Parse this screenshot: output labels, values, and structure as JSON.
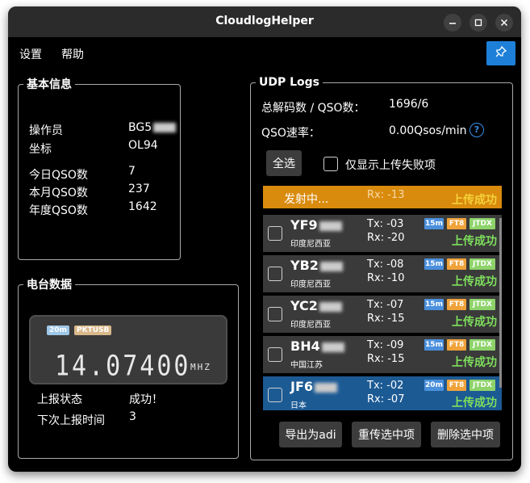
{
  "window": {
    "title": "CloudlogHelper"
  },
  "menu": {
    "items": [
      "设置",
      "帮助"
    ]
  },
  "basic_info": {
    "legend": "基本信息",
    "operator_label": "操作员",
    "operator_value": "BG5",
    "grid_label": "坐标",
    "grid_value": "OL94",
    "today_label": "今日QSO数",
    "today_value": "7",
    "month_label": "本月QSO数",
    "month_value": "237",
    "year_label": "年度QSO数",
    "year_value": "1642"
  },
  "radio": {
    "legend": "电台数据",
    "band_tag": "20m",
    "mode_tag": "PKTUSB",
    "frequency": "14.07400",
    "unit": "MHZ",
    "report_status_label": "上报状态",
    "report_status_value": "成功！",
    "next_report_label": "下次上报时间",
    "next_report_value": "3"
  },
  "udp": {
    "legend": "UDP Logs",
    "decode_label": "总解码数 / QSO数：",
    "decode_value": "1696/6",
    "rate_label": "QSO速率：",
    "rate_value": "0.00Qsos/min",
    "help_icon": "?",
    "select_all": "全选",
    "only_failed": "仅显示上传失败项",
    "transmitting": {
      "text": "发射中...",
      "rx": "Rx:  -13",
      "status": "上传成功"
    },
    "entries": [
      {
        "call": "YF9",
        "country": "印度尼西亚",
        "tx": "Tx:  -03",
        "rx": "Rx:  -20",
        "band": "15m",
        "mode": "FT8",
        "app": "JTDX",
        "status": "上传成功"
      },
      {
        "call": "YB2",
        "country": "印度尼西亚",
        "tx": "Tx:  -08",
        "rx": "Rx:  -10",
        "band": "15m",
        "mode": "FT8",
        "app": "JTDX",
        "status": "上传成功"
      },
      {
        "call": "YC2",
        "country": "印度尼西亚",
        "tx": "Tx:  -07",
        "rx": "Rx:  -15",
        "band": "15m",
        "mode": "FT8",
        "app": "JTDX",
        "status": "上传成功"
      },
      {
        "call": "BH4",
        "country": "中国江苏",
        "tx": "Tx:  -09",
        "rx": "Rx:  -15",
        "band": "15m",
        "mode": "FT8",
        "app": "JTDX",
        "status": "上传成功"
      },
      {
        "call": "JF6",
        "country": "日本",
        "tx": "Tx:  -02",
        "rx": "Rx:  -07",
        "band": "20m",
        "mode": "FT8",
        "app": "JTDX",
        "status": "上传成功"
      }
    ],
    "export_button": "导出为adi",
    "retry_button": "重传选中项",
    "delete_button": "删除选中项"
  },
  "colors": {
    "accent": "#1e7fd8",
    "selected_row": "#1c5a94",
    "transmit_bar": "#d98b0e",
    "success": "#7ee05c",
    "badge_band": "#4a8fdc",
    "badge_mode": "#f0a23a",
    "badge_app": "#8dd36a"
  },
  "icons": {
    "minimize": "minimize-icon",
    "maximize": "maximize-icon",
    "close": "close-icon",
    "pin": "pin-icon",
    "help": "help-icon"
  }
}
